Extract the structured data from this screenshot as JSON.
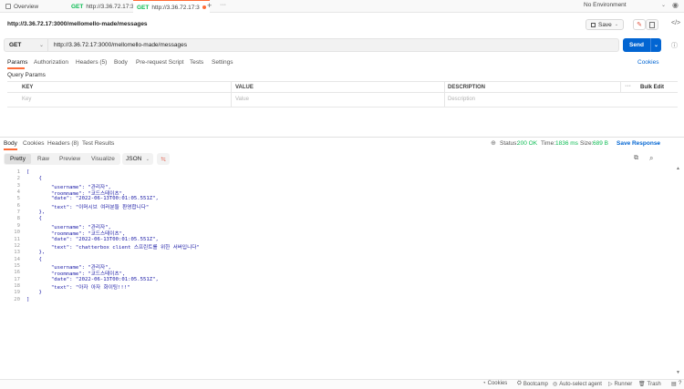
{
  "tabs": [
    {
      "label": "Overview",
      "method": ""
    },
    {
      "label": "http://3.36.72.17:3",
      "method": "GET"
    },
    {
      "label": "http://3.36.72.17:3",
      "method": "GET"
    }
  ],
  "environment": "No Environment",
  "request": {
    "name": "http://3.36.72.17:3000/mellomello-made/messages",
    "save_label": "Save",
    "method": "GET",
    "url": "http://3.36.72.17:3000/mellomello-made/messages",
    "send_label": "Send"
  },
  "request_tabs": [
    {
      "label": "Params"
    },
    {
      "label": "Authorization"
    },
    {
      "label": "Headers (5)"
    },
    {
      "label": "Body"
    },
    {
      "label": "Pre-request Script"
    },
    {
      "label": "Tests"
    },
    {
      "label": "Settings"
    }
  ],
  "cookies_link": "Cookies",
  "query_params": {
    "title": "Query Params",
    "headers": {
      "key": "KEY",
      "value": "VALUE",
      "description": "DESCRIPTION",
      "bulk": "Bulk Edit"
    },
    "placeholders": {
      "key": "Key",
      "value": "Value",
      "description": "Description"
    }
  },
  "response": {
    "tabs": [
      {
        "label": "Body"
      },
      {
        "label": "Cookies"
      },
      {
        "label": "Headers (8)"
      },
      {
        "label": "Test Results"
      }
    ],
    "status_label": "Status:",
    "status_value": "200 OK",
    "time_label": "Time:",
    "time_value": "1836 ms",
    "size_label": "Size:",
    "size_value": "689 B",
    "save_response": "Save Response",
    "view_tabs": [
      {
        "label": "Pretty"
      },
      {
        "label": "Raw"
      },
      {
        "label": "Preview"
      },
      {
        "label": "Visualize"
      }
    ],
    "format": "JSON",
    "line_numbers": [
      "1",
      "2",
      "3",
      "4",
      "5",
      "6",
      "7",
      "8",
      "9",
      "10",
      "11",
      "12",
      "13",
      "14",
      "15",
      "16",
      "17",
      "18",
      "19",
      "20"
    ],
    "lines": [
      "[",
      "    {",
      "        \"username\": \"관리자\",",
      "        \"roomname\": \"코드스테이츠\",",
      "        \"date\": \"2022-06-13T00:01:05.551Z\",",
      "        \"text\": \"이머시브 여러분들 환영합니다\"",
      "    },",
      "    {",
      "        \"username\": \"관리자\",",
      "        \"roomname\": \"코드스테이츠\",",
      "        \"date\": \"2022-06-13T00:01:05.551Z\",",
      "        \"text\": \"chatterbox client 스프린트를 위한 서버입니다\"",
      "    },",
      "    {",
      "        \"username\": \"관리자\",",
      "        \"roomname\": \"코드스테이츠\",",
      "        \"date\": \"2022-06-13T00:01:05.551Z\",",
      "        \"text\": \"아자 아자 화이팅!!!\"",
      "    }",
      "]"
    ]
  },
  "footer": {
    "cookies": "Cookies",
    "bootcamp": "Bootcamp",
    "auto_select": "Auto-select agent",
    "runner": "Runner",
    "trash": "Trash"
  },
  "colors": {
    "accent": "#ff6c37",
    "send": "#0265d2",
    "get": "#0cbb52",
    "status_ok": "#0cbb52"
  }
}
